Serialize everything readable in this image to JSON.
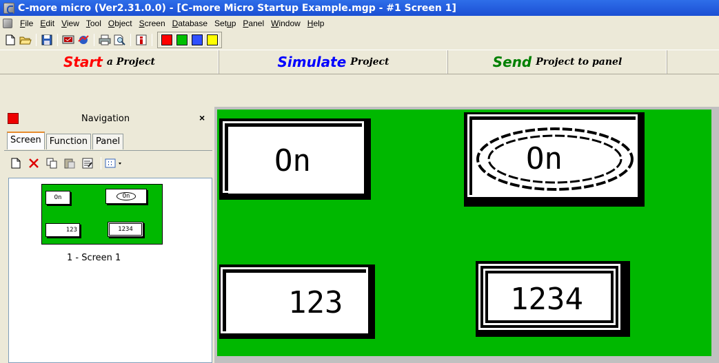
{
  "window": {
    "title": "C-more micro (Ver2.31.0.0) - [C-more Micro Startup Example.mgp - #1 Screen 1]"
  },
  "menu": [
    {
      "pre": "",
      "ul": "F",
      "post": "ile"
    },
    {
      "pre": "",
      "ul": "E",
      "post": "dit"
    },
    {
      "pre": "",
      "ul": "V",
      "post": "iew"
    },
    {
      "pre": "",
      "ul": "T",
      "post": "ool"
    },
    {
      "pre": "",
      "ul": "O",
      "post": "bject"
    },
    {
      "pre": "",
      "ul": "S",
      "post": "creen"
    },
    {
      "pre": "",
      "ul": "D",
      "post": "atabase"
    },
    {
      "pre": "Set",
      "ul": "u",
      "post": "p"
    },
    {
      "pre": "",
      "ul": "P",
      "post": "anel"
    },
    {
      "pre": "",
      "ul": "W",
      "post": "indow"
    },
    {
      "pre": "",
      "ul": "H",
      "post": "elp"
    }
  ],
  "toolbar": {
    "colors": [
      "#ff0000",
      "#00c000",
      "#3050ff",
      "#ffff00"
    ]
  },
  "workflow": {
    "start": {
      "big": "Start",
      "small": "a Project",
      "color": "#ff0000"
    },
    "simulate": {
      "big": "Simulate",
      "small": "Project",
      "color": "#0000ff"
    },
    "send": {
      "big": "Send",
      "small": "Project to panel",
      "color": "#008000"
    }
  },
  "navigation": {
    "title": "Navigation",
    "close": "×",
    "tabs": [
      "Screen",
      "Function",
      "Panel"
    ],
    "thumbnail": {
      "btn1": "On",
      "btn2": "On",
      "num1": "123",
      "num2": "1234",
      "label": "1 - Screen 1"
    }
  },
  "screen": {
    "background": "#00b800",
    "button_on_1": "On",
    "button_on_2": "On",
    "numeric_1": "123",
    "numeric_2": "1234"
  }
}
